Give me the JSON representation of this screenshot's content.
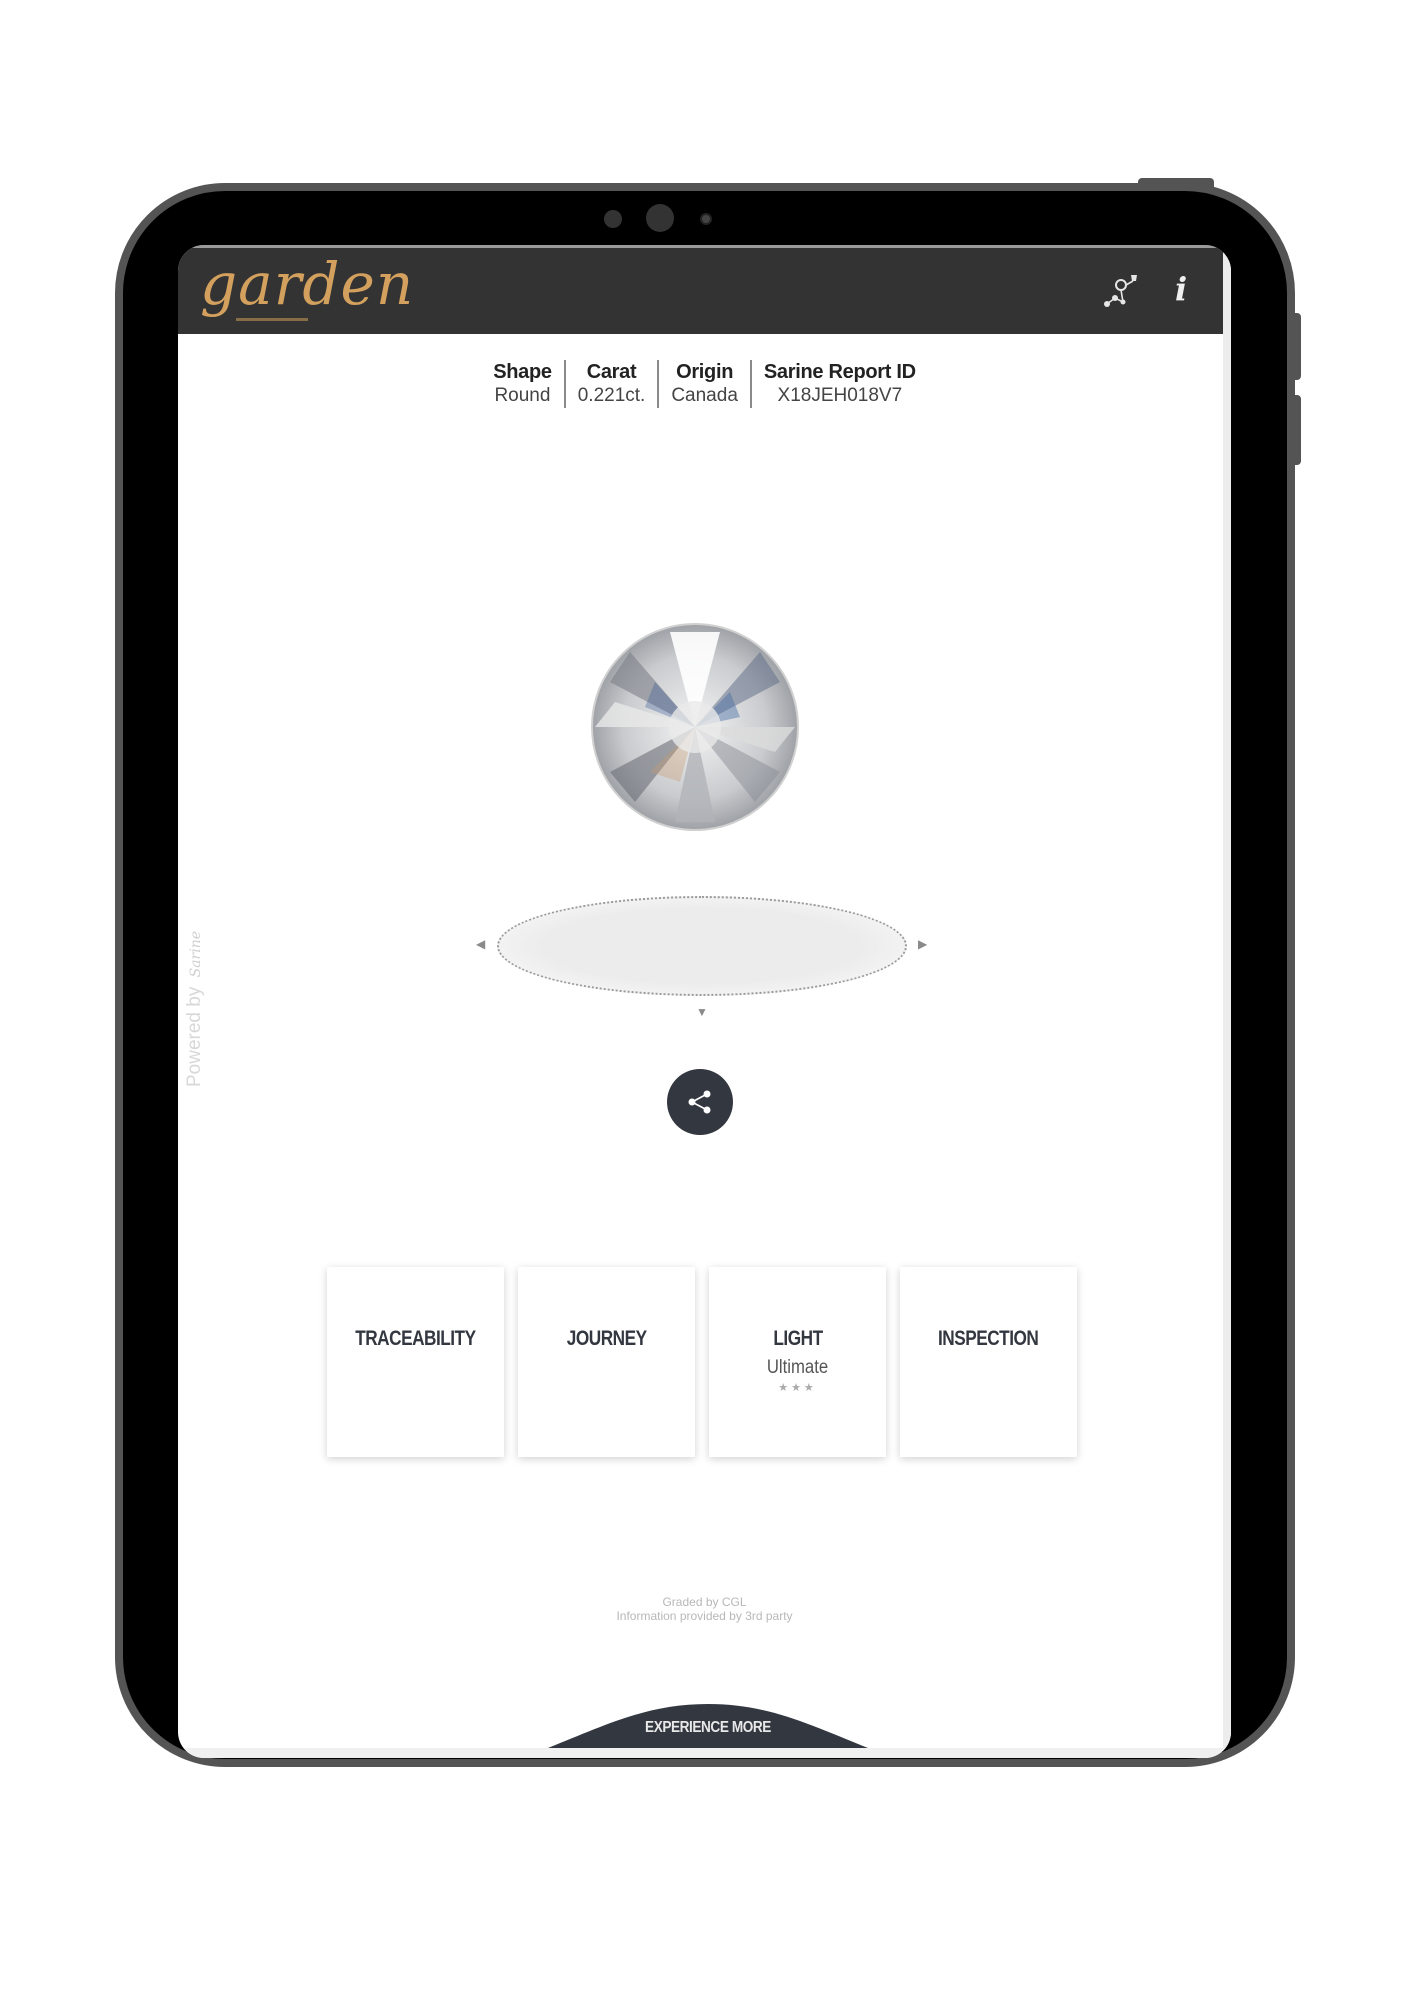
{
  "header": {
    "logo_text": "garden",
    "icons": [
      "trace-icon",
      "info-icon"
    ],
    "info_glyph": "i",
    "accent_color": "#d3a05e",
    "background_color": "#333333"
  },
  "stats": [
    {
      "label": "Shape",
      "value": "Round"
    },
    {
      "label": "Carat",
      "value": "0.221ct."
    },
    {
      "label": "Origin",
      "value": "Canada"
    },
    {
      "label": "Sarine Report ID",
      "value": "X18JEH018V7"
    }
  ],
  "viewer": {
    "left_arrow": "◀",
    "right_arrow": "▶",
    "down_arrow": "▼"
  },
  "powered_by": {
    "text": "Powered by",
    "brand": "Sarine"
  },
  "cards": [
    {
      "title": "TRACEABILITY"
    },
    {
      "title": "JOURNEY"
    },
    {
      "title": "LIGHT",
      "subtitle": "Ultimate",
      "rating": 3,
      "rating_max": 3,
      "stars": "★★★"
    },
    {
      "title": "INSPECTION"
    }
  ],
  "footer": {
    "graded_by": "Graded by CGL",
    "info": "Information provided by 3rd party",
    "experience_more": "EXPERIENCE MORE"
  }
}
